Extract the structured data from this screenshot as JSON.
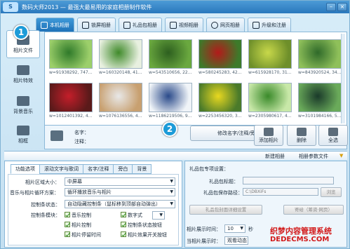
{
  "titlebar": {
    "logo": "S",
    "title": "数码大师2013 — 最强大最易用的家庭相册制作软件"
  },
  "tabs": [
    {
      "label": "本机相册",
      "active": true
    },
    {
      "label": "锁屏相册"
    },
    {
      "label": "礼品包相册"
    },
    {
      "label": "视频相册"
    },
    {
      "label": "网页相册"
    },
    {
      "label": "升级和注册"
    }
  ],
  "sidebar": {
    "items": [
      "相片文件",
      "相片特效",
      "背景音乐",
      "相框"
    ]
  },
  "callouts": {
    "one": "1",
    "two": "2"
  },
  "thumbnails": [
    {
      "caption": "w=91938292, 747...",
      "c1": "#2f7a2a",
      "c2": "#9ccf6a"
    },
    {
      "caption": "w=160320148, 41...",
      "c1": "#3f8a2a",
      "c2": "#e8f0e0"
    },
    {
      "caption": "w=543510656, 22...",
      "c1": "#2d5f1f",
      "c2": "#6aa83f"
    },
    {
      "caption": "w=580245283, 42...",
      "c1": "#b31a1a",
      "c2": "#3d7a2a"
    },
    {
      "caption": "w=615928170, 31...",
      "c1": "#c8d84a",
      "c2": "#6e8f2a"
    },
    {
      "caption": "w=843920524, 34...",
      "c1": "#2f6a2a",
      "c2": "#8fc05a"
    },
    {
      "caption": "w=1012401392, 4...",
      "c1": "#c41e2a",
      "c2": "#5a1a1a"
    },
    {
      "caption": "w=1076136556, 4...",
      "c1": "#e8e8e8",
      "c2": "#c8a070"
    },
    {
      "caption": "w=1186219506, 9...",
      "c1": "#2a4a8a",
      "c2": "#f0f4f8"
    },
    {
      "caption": "w=2253456320, 3...",
      "c1": "#e8d820",
      "c2": "#4a7a2a"
    },
    {
      "caption": "w=2305980617, 4...",
      "c1": "#3a8a2a",
      "c2": "#c8e8a8"
    },
    {
      "caption": "w=3101984166, 5...",
      "c1": "#1a3a2a",
      "c2": "#6aaa5a"
    }
  ],
  "info": {
    "name_label": "名字：",
    "note_label": "注释："
  },
  "buttons": {
    "edit": "修改名字/注释/旁白",
    "add": "添加相片",
    "delete": "删除",
    "select_all": "全选"
  },
  "strip": {
    "new_album": "新建相册",
    "album_params": "相册参数文件"
  },
  "options": {
    "tabs": [
      "功能选项",
      "滚动文字与歌词",
      "名字/注释",
      "旁白",
      "背景"
    ],
    "area_size_label": "相片区域大小：",
    "area_size_value": "中屏幕",
    "loop_label": "音乐与相片循环方案：",
    "loop_value": "循环播放音乐与相片",
    "control_label": "控制条状态：",
    "control_value": "自动隐藏控制条（鼠标移到顶部自动弹出）",
    "modules_label": "控制条模块：",
    "modules": [
      "音乐控制",
      "数字式",
      "相片控制",
      "控制条状态按钮",
      "相片停留时间",
      "相片效果开关按钮"
    ]
  },
  "gift": {
    "header": "礼品包专项设置：",
    "title_label": "礼品包标题：",
    "path_label": "礼品包保存路径：",
    "path_value": "C:\\DBXiFs",
    "browse": "浏览",
    "preview_btn": "礼品包封面详细设置",
    "share_btn": "寄给（筹资·网页）"
  },
  "display": {
    "time_label": "相片展示时间：",
    "time_value": "10",
    "time_unit": "秒",
    "mode_label": "当相片展示时：",
    "mode_value": "观看动态"
  },
  "watermark": {
    "line1": "织梦内容管理系统",
    "line2": "DEDECMS.COM"
  }
}
